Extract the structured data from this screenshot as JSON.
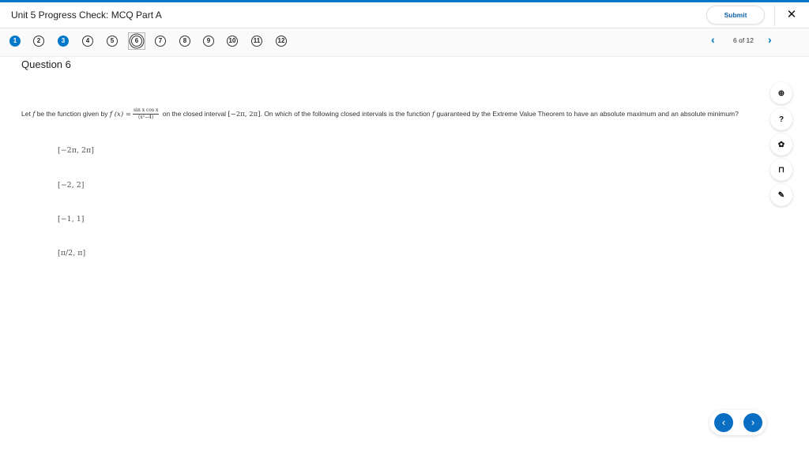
{
  "header": {
    "title": "Unit 5 Progress Check: MCQ Part A",
    "submit_label": "Submit",
    "close_glyph": "✕"
  },
  "question_nav": {
    "questions": [
      {
        "label": "1",
        "state": "answered"
      },
      {
        "label": "2",
        "state": "unanswered"
      },
      {
        "label": "3",
        "state": "answered"
      },
      {
        "label": "4",
        "state": "unanswered"
      },
      {
        "label": "5",
        "state": "unanswered"
      },
      {
        "label": "6",
        "state": "current"
      },
      {
        "label": "7",
        "state": "unanswered"
      },
      {
        "label": "8",
        "state": "unanswered"
      },
      {
        "label": "9",
        "state": "unanswered"
      },
      {
        "label": "10",
        "state": "unanswered"
      },
      {
        "label": "11",
        "state": "unanswered"
      },
      {
        "label": "12",
        "state": "unanswered"
      }
    ],
    "prev_glyph": "‹",
    "next_glyph": "›",
    "position": "6 of 12"
  },
  "question": {
    "title": "Question 6",
    "stem": {
      "part1": "Let ",
      "f": "f",
      "part2": " be the function given by ",
      "fx": "f (x) =",
      "numerator": "sin x cos x",
      "denominator": "(x²−4)",
      "part3": " on the closed interval ",
      "interval": "[−2π, 2π]",
      "part4": ". On which of the following closed intervals is the function ",
      "f2": "f",
      "part5": " guaranteed by the Extreme Value Theorem to have an absolute maximum and an absolute minimum?"
    },
    "choices": [
      {
        "label": "[−2π, 2π]"
      },
      {
        "label": "[−2, 2]"
      },
      {
        "label": "[−1, 1]"
      },
      {
        "label": "[π/2, π]"
      }
    ]
  },
  "tools": [
    {
      "name": "zoom-in",
      "glyph": "⊕"
    },
    {
      "name": "help",
      "glyph": "?"
    },
    {
      "name": "settings",
      "glyph": "✿"
    },
    {
      "name": "bookmark",
      "glyph": "⊓"
    },
    {
      "name": "annotate",
      "glyph": "✎"
    }
  ],
  "bottom_nav": {
    "prev_glyph": "‹",
    "next_glyph": "›"
  }
}
